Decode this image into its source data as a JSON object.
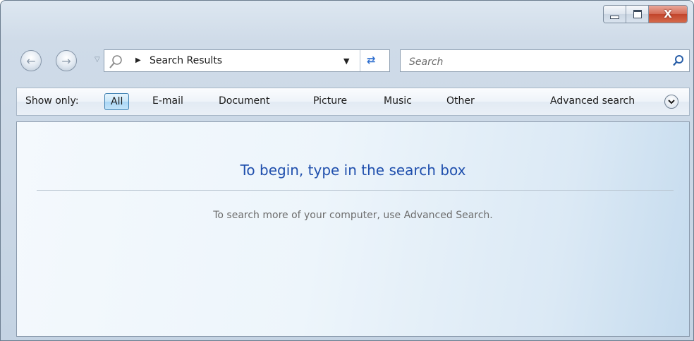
{
  "window": {
    "caption_buttons": {
      "minimize_icon": "minimize-icon",
      "maximize_icon": "maximize-icon",
      "close_label": "X"
    }
  },
  "navigation": {
    "back_icon": "back-arrow-icon",
    "forward_icon": "forward-arrow-icon",
    "dropdown_icon": "chevron-down-icon"
  },
  "address_bar": {
    "breadcrumb": "Search Results",
    "icon": "search-folder-icon",
    "refresh_icon": "refresh-icon"
  },
  "search": {
    "placeholder": "Search",
    "value": "",
    "icon": "magnifier-icon"
  },
  "filter_bar": {
    "show_only_label": "Show only:",
    "filters": [
      "All",
      "E-mail",
      "Document",
      "Picture",
      "Music",
      "Other"
    ],
    "selected": "All",
    "advanced_search_label": "Advanced search"
  },
  "content": {
    "heading": "To begin, type in the search box",
    "hint": "To search more of your computer, use Advanced Search."
  },
  "colors": {
    "heading": "#1f4fad",
    "hint": "#6d6d6d",
    "close_button": "#c2452c",
    "selected_filter": "#a9d6f5"
  }
}
